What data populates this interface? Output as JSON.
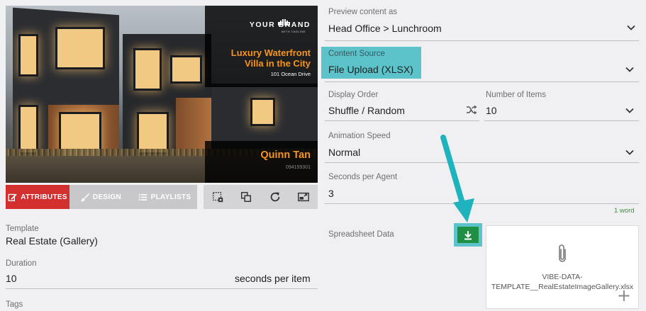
{
  "preview": {
    "brand_name": "YOUR BRAND",
    "brand_sub": "WITH TAGLINE",
    "listing_title_line1": "Luxury Waterfront",
    "listing_title_line2": "Villa in the City",
    "listing_address": "101 Ocean Drive",
    "agent_name": "Quinn Tan",
    "agent_phone": "094159301"
  },
  "tabs": [
    {
      "label": "ATTRIBUTES",
      "active": true
    },
    {
      "label": "DESIGN",
      "active": false
    },
    {
      "label": "PLAYLISTS",
      "active": false
    }
  ],
  "tools": [
    "crop-icon",
    "layers-icon",
    "refresh-icon",
    "expand-icon"
  ],
  "left_fields": {
    "template_label": "Template",
    "template_value": "Real Estate (Gallery)",
    "duration_label": "Duration",
    "duration_value": "10",
    "duration_suffix": "seconds per item",
    "tags_label": "Tags"
  },
  "right_fields": {
    "preview_label": "Preview content as",
    "preview_value": "Head Office > Lunchroom",
    "source_label": "Content Source",
    "source_value": "File Upload (XLSX)",
    "order_label": "Display Order",
    "order_value": "Shuffle / Random",
    "items_label": "Number of Items",
    "items_value": "10",
    "speed_label": "Animation Speed",
    "speed_value": "Normal",
    "seconds_label": "Seconds per Agent",
    "seconds_value": "3",
    "word_count": "1 word",
    "spreadsheet_label": "Spreadsheet Data",
    "file_name_line1": "VIBE-DATA-",
    "file_name_line2": "TEMPLATE__RealEstateImageGallery.xlsx"
  },
  "colors": {
    "accent_red": "#d32f2f",
    "highlight_teal": "#5bc3c9",
    "download_green": "#1e8f43",
    "listing_orange": "#f7941d"
  }
}
